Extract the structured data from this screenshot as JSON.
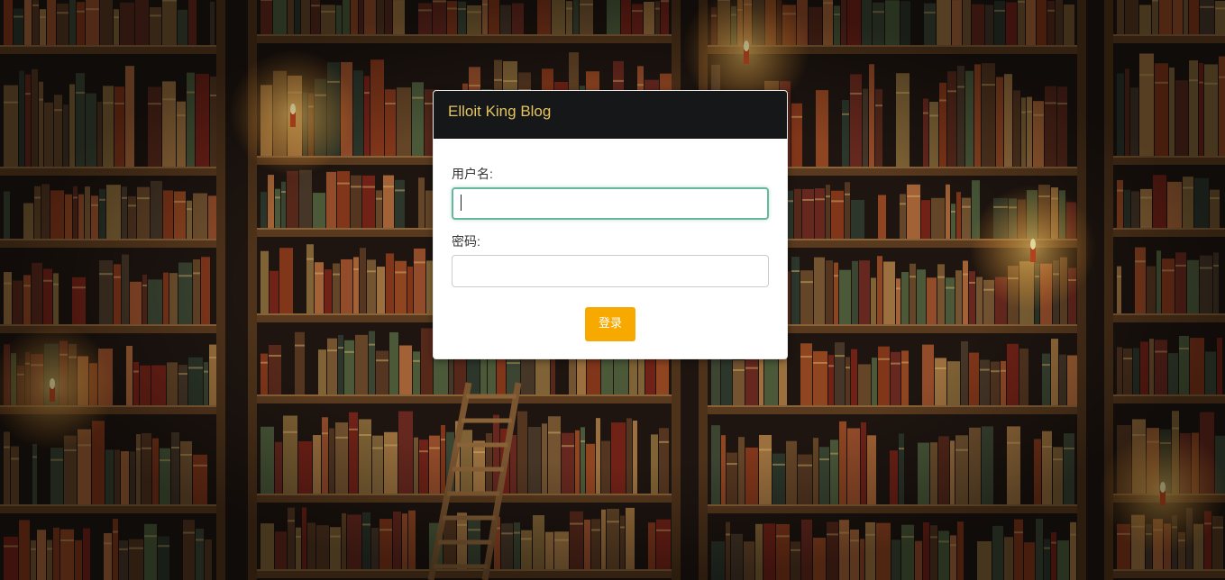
{
  "login": {
    "title": "Elloit King Blog",
    "username_label": "用户名:",
    "username_value": "",
    "password_label": "密码:",
    "password_value": "",
    "submit_label": "登录"
  },
  "colors": {
    "header_bg": "#151719",
    "title_text": "#e5c35f",
    "button_bg": "#f8a900",
    "focus_border": "#66b6a0"
  },
  "background": {
    "description_icon": "bookshelf-background"
  }
}
